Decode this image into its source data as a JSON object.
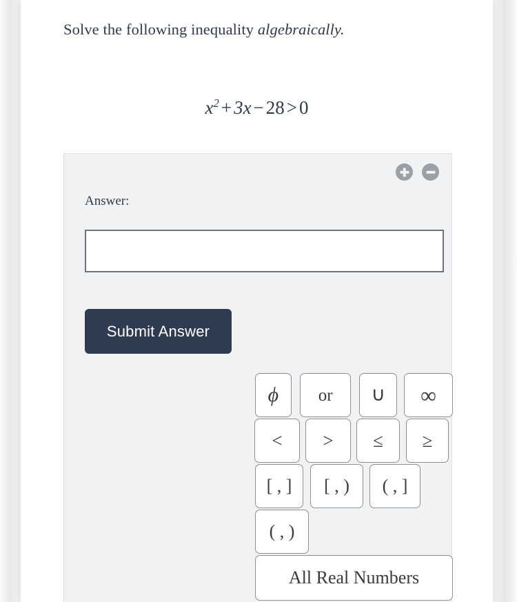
{
  "prompt": {
    "text_plain": "Solve the following inequality ",
    "text_emphasis": "algebraically."
  },
  "equation": {
    "variable": "x",
    "exponent": "2",
    "plus": "+",
    "coefficient_term": "3x",
    "minus": "−",
    "constant": "28",
    "relation": ">",
    "right_side": "0",
    "full_text": "x² + 3x − 28 > 0"
  },
  "panel": {
    "zoom_in_label": "zoom-in",
    "zoom_out_label": "zoom-out",
    "answer_label": "Answer:",
    "answer_value": "",
    "answer_placeholder": "",
    "submit_label": "Submit Answer"
  },
  "keypad": {
    "rows": [
      [
        {
          "label": "ϕ",
          "name": "empty-set"
        },
        {
          "label": "or",
          "name": "or"
        },
        {
          "label": "∪",
          "name": "union"
        },
        {
          "label": "∞",
          "name": "infinity"
        }
      ],
      [
        {
          "label": "<",
          "name": "less-than"
        },
        {
          "label": ">",
          "name": "greater-than"
        },
        {
          "label": "≤",
          "name": "less-than-or-equal"
        },
        {
          "label": "≥",
          "name": "greater-than-or-equal"
        }
      ],
      [
        {
          "label": "[ , ]",
          "name": "closed-interval"
        },
        {
          "label": "[ , )",
          "name": "half-open-interval-right"
        },
        {
          "label": "( , ]",
          "name": "half-open-interval-left"
        }
      ],
      [
        {
          "label": "( , )",
          "name": "open-interval"
        }
      ],
      [
        {
          "label": "All Real Numbers",
          "name": "all-real-numbers"
        }
      ]
    ]
  },
  "colors": {
    "page_background": "#f7f7f7",
    "card_background": "#ffffff",
    "panel_background": "#f1f2f4",
    "submit_button": "#2e3b50",
    "text": "#2f3a4a",
    "input_border": "#6e7175",
    "key_border": "#8c9094",
    "zoom_button": "#9aa0a6"
  }
}
